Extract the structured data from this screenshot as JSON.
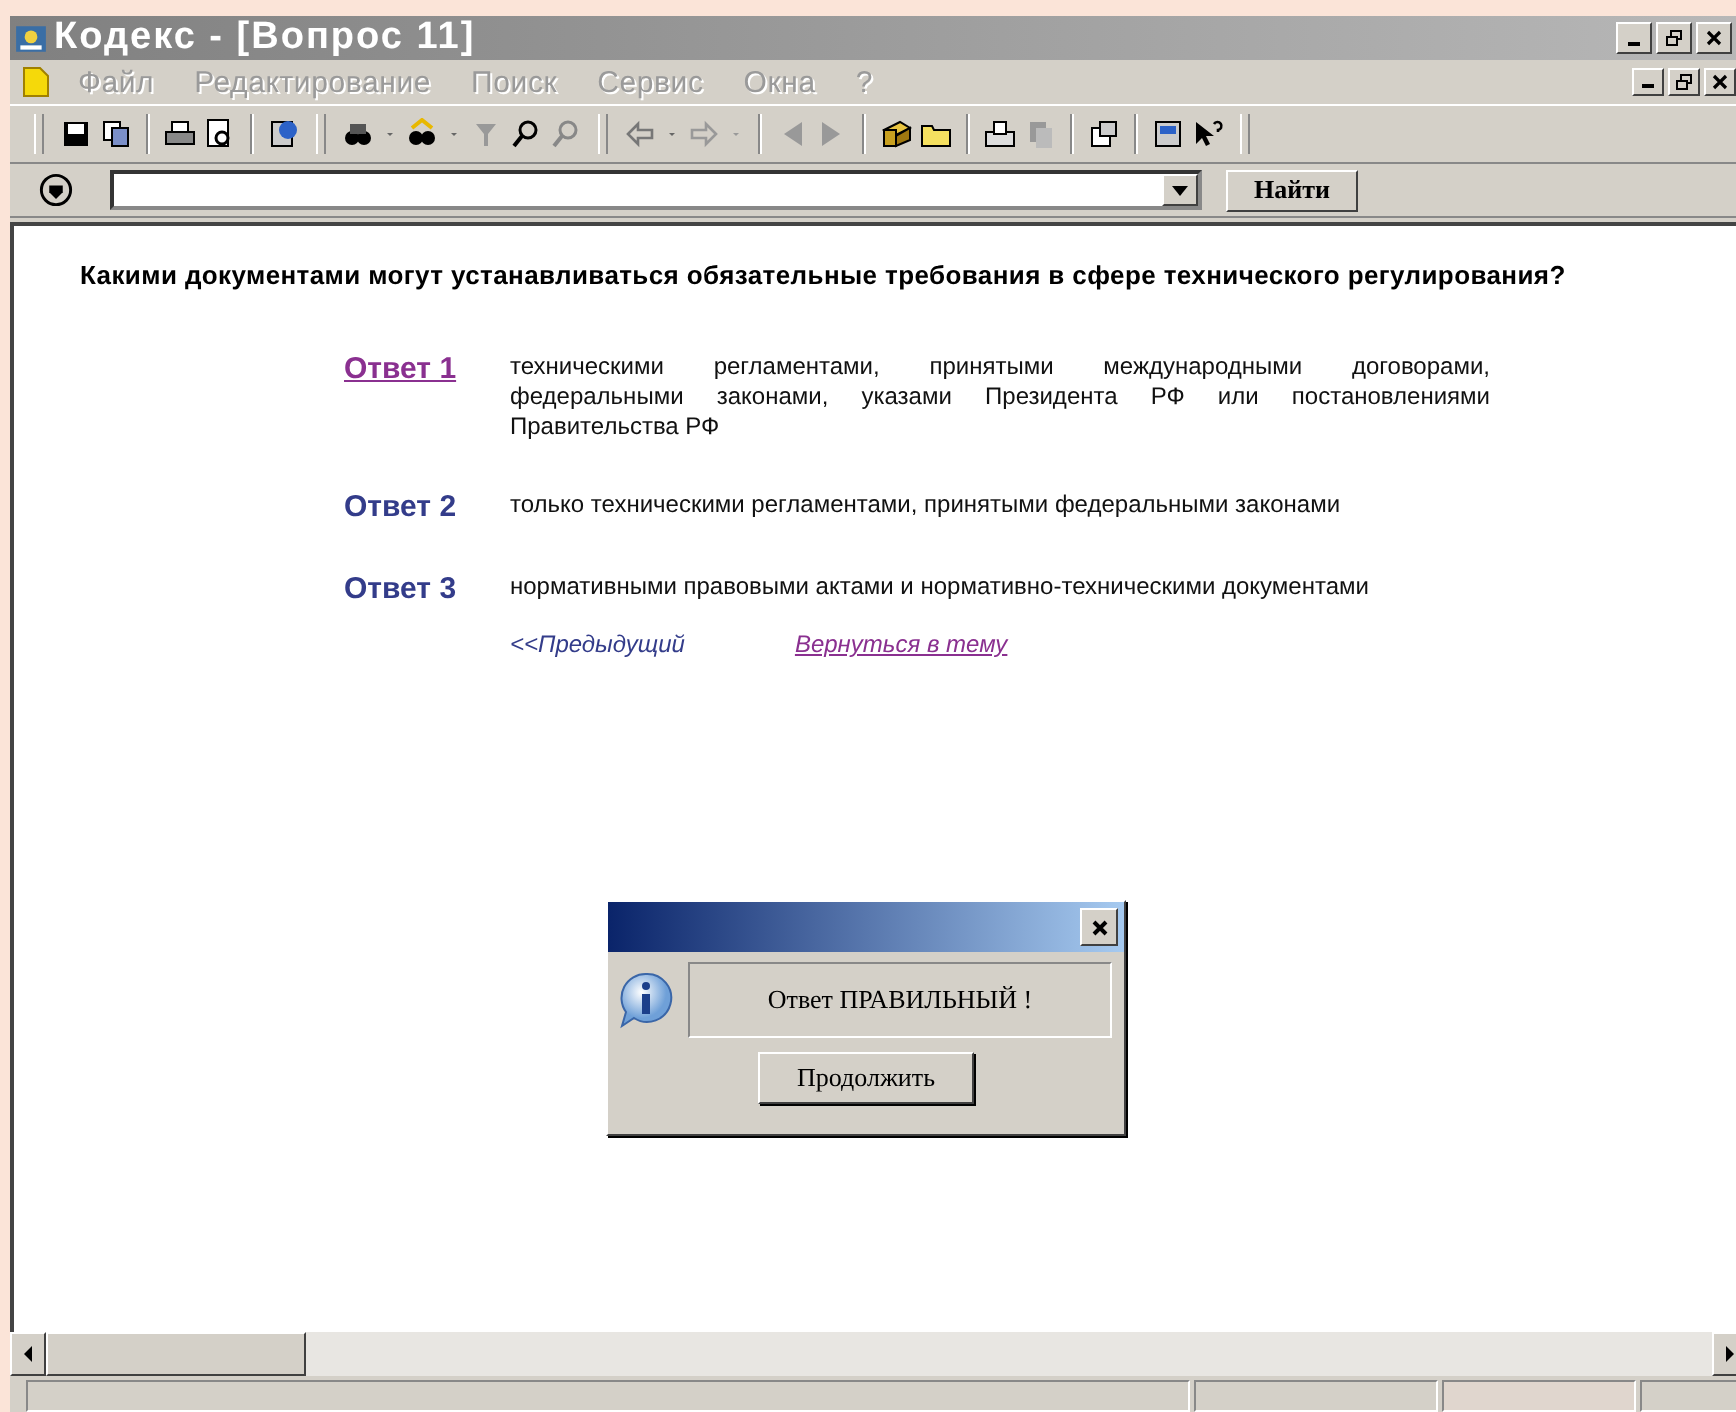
{
  "window": {
    "title": "Кодекс - [Вопрос 11]",
    "active": false
  },
  "menu": [
    {
      "label": "Файл",
      "disabled": true
    },
    {
      "label": "Редактирование",
      "disabled": true
    },
    {
      "label": "Поиск",
      "disabled": true
    },
    {
      "label": "Сервис",
      "disabled": true
    },
    {
      "label": "Окна",
      "disabled": true
    },
    {
      "label": "?",
      "disabled": true
    }
  ],
  "search": {
    "button": "Найти"
  },
  "question": "Какими документами могут устанавливаться обязательные требования в сфере технического регулирования?",
  "answers": [
    {
      "label": "Ответ 1",
      "visited": true,
      "text": "техническими регламентами, принятыми международными договорами, федеральными законами, указами Президента РФ или постановлениями Правительства РФ"
    },
    {
      "label": "Ответ 2",
      "visited": false,
      "text": "только техническими регламентами, принятыми федеральными законами"
    },
    {
      "label": "Ответ 3",
      "visited": false,
      "text": "нормативными правовыми актами и нормативно-техническими документами"
    }
  ],
  "nav_links": [
    {
      "label": "<<Предыдущий",
      "visited": false
    },
    {
      "label": "Вернуться в тему",
      "visited": true
    }
  ],
  "dialog": {
    "message": "Ответ ПРАВИЛЬНЫЙ !",
    "button": "Продолжить"
  }
}
